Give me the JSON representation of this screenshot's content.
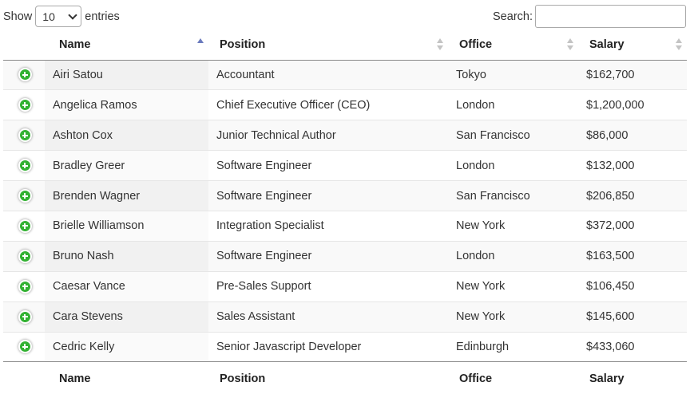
{
  "length_menu": {
    "show_label": "Show",
    "selected": "10",
    "entries_label": "entries"
  },
  "search": {
    "label": "Search:",
    "value": "",
    "placeholder": ""
  },
  "columns": [
    "Name",
    "Position",
    "Office",
    "Salary"
  ],
  "sort": {
    "column": "Name",
    "direction": "ascending"
  },
  "rows": [
    {
      "name": "Airi Satou",
      "position": "Accountant",
      "office": "Tokyo",
      "salary": "$162,700"
    },
    {
      "name": "Angelica Ramos",
      "position": "Chief Executive Officer (CEO)",
      "office": "London",
      "salary": "$1,200,000"
    },
    {
      "name": "Ashton Cox",
      "position": "Junior Technical Author",
      "office": "San Francisco",
      "salary": "$86,000"
    },
    {
      "name": "Bradley Greer",
      "position": "Software Engineer",
      "office": "London",
      "salary": "$132,000"
    },
    {
      "name": "Brenden Wagner",
      "position": "Software Engineer",
      "office": "San Francisco",
      "salary": "$206,850"
    },
    {
      "name": "Brielle Williamson",
      "position": "Integration Specialist",
      "office": "New York",
      "salary": "$372,000"
    },
    {
      "name": "Bruno Nash",
      "position": "Software Engineer",
      "office": "London",
      "salary": "$163,500"
    },
    {
      "name": "Caesar Vance",
      "position": "Pre-Sales Support",
      "office": "New York",
      "salary": "$106,450"
    },
    {
      "name": "Cara Stevens",
      "position": "Sales Assistant",
      "office": "New York",
      "salary": "$145,600"
    },
    {
      "name": "Cedric Kelly",
      "position": "Senior Javascript Developer",
      "office": "Edinburgh",
      "salary": "$433,060"
    }
  ],
  "colors": {
    "expand_button": "#31b131",
    "sort_active": "#6b7bbd",
    "sort_inactive": "#c4c4c4"
  },
  "icons": {
    "expand": "plus-circle-icon",
    "sort_asc": "sort-asc-icon",
    "sort_both": "sort-both-icon"
  }
}
